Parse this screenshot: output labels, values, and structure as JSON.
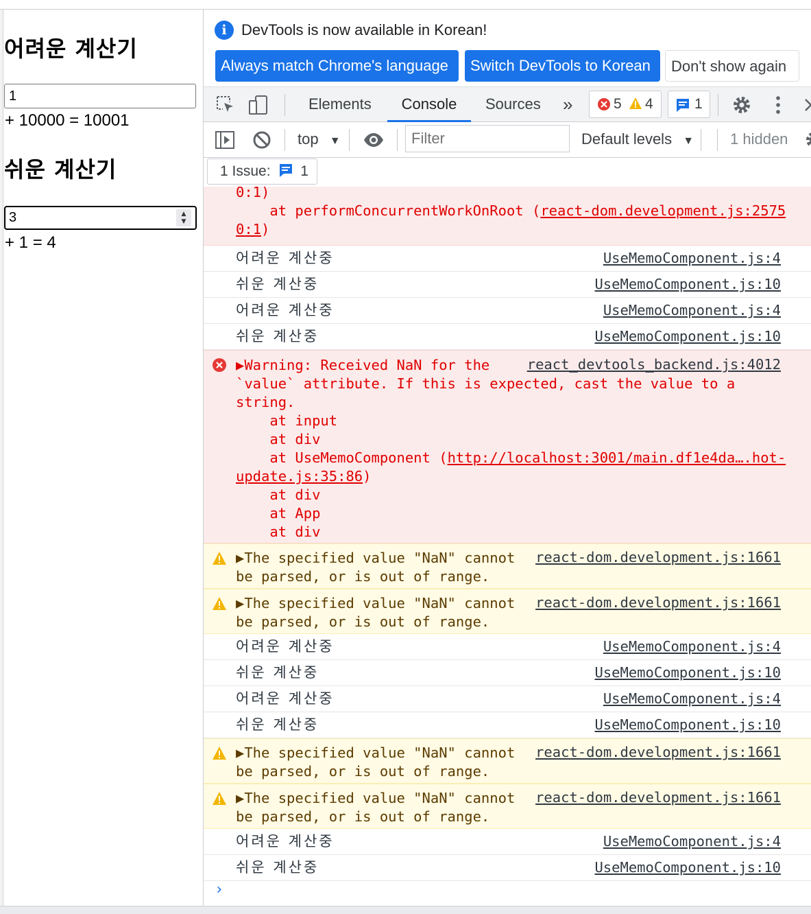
{
  "page": {
    "hard_title": "어려운 계산기",
    "hard_input_value": "1",
    "hard_result": "+ 10000 = 10001",
    "easy_title": "쉬운 계산기",
    "easy_input_value": "3",
    "easy_result": "+ 1 = 4"
  },
  "infobar": {
    "message": "DevTools is now available in Korean!",
    "btn_match": "Always match Chrome's language",
    "btn_switch": "Switch DevTools to Korean",
    "btn_dismiss": "Don't show again"
  },
  "tabs": {
    "elements": "Elements",
    "console": "Console",
    "sources": "Sources",
    "more": "»",
    "errors_count": "5",
    "warnings_count": "4",
    "messages_count": "1"
  },
  "filterbar": {
    "context": "top",
    "filter_placeholder": "Filter",
    "levels": "Default levels",
    "hidden": "1 hidden"
  },
  "issues": {
    "label": "1 Issue:",
    "count": "1"
  },
  "console": {
    "entries": [
      {
        "text_a": "0:1)",
        "text_b": "    at performConcurrentWorkOnRoot (",
        "link": "react-dom.development.js:2575\n0:1",
        "text_c": ")"
      },
      {
        "text": "어려운 계산중",
        "source": "UseMemoComponent.js:4"
      },
      {
        "text": "쉬운 계산중",
        "source": "UseMemoComponent.js:10"
      },
      {
        "text": "어려운 계산중",
        "source": "UseMemoComponent.js:4"
      },
      {
        "text": "쉬운 계산중",
        "source": "UseMemoComponent.js:10"
      },
      {
        "text": "▶Warning: Received NaN for the\n`value` attribute. If this is expected, cast the value to a\nstring.\n    at input\n    at div\n    at UseMemoComponent (",
        "link": "http://localhost:3001/main.df1e4da….hot-\nupdate.js:35:86",
        "text_after": ")\n    at div\n    at App\n    at div",
        "source": "react_devtools_backend.js:4012"
      },
      {
        "text": "▶The specified value \"NaN\" cannot\nbe parsed, or is out of range.",
        "source": "react-dom.development.js:1661"
      },
      {
        "text": "▶The specified value \"NaN\" cannot\nbe parsed, or is out of range.",
        "source": "react-dom.development.js:1661"
      },
      {
        "text": "어려운 계산중",
        "source": "UseMemoComponent.js:4"
      },
      {
        "text": "쉬운 계산중",
        "source": "UseMemoComponent.js:10"
      },
      {
        "text": "어려운 계산중",
        "source": "UseMemoComponent.js:4"
      },
      {
        "text": "쉬운 계산중",
        "source": "UseMemoComponent.js:10"
      },
      {
        "text": "▶The specified value \"NaN\" cannot\nbe parsed, or is out of range.",
        "source": "react-dom.development.js:1661"
      },
      {
        "text": "▶The specified value \"NaN\" cannot\nbe parsed, or is out of range.",
        "source": "react-dom.development.js:1661"
      },
      {
        "text": "어려운 계산중",
        "source": "UseMemoComponent.js:4"
      },
      {
        "text": "쉬운 계산중",
        "source": "UseMemoComponent.js:10"
      }
    ],
    "prompt": "›"
  },
  "colors": {
    "accent": "#1a73e8",
    "error": "#e00000",
    "error_bg": "#fcebeb",
    "warning_bg": "#fffbe5",
    "warning_icon": "#f2b600"
  }
}
